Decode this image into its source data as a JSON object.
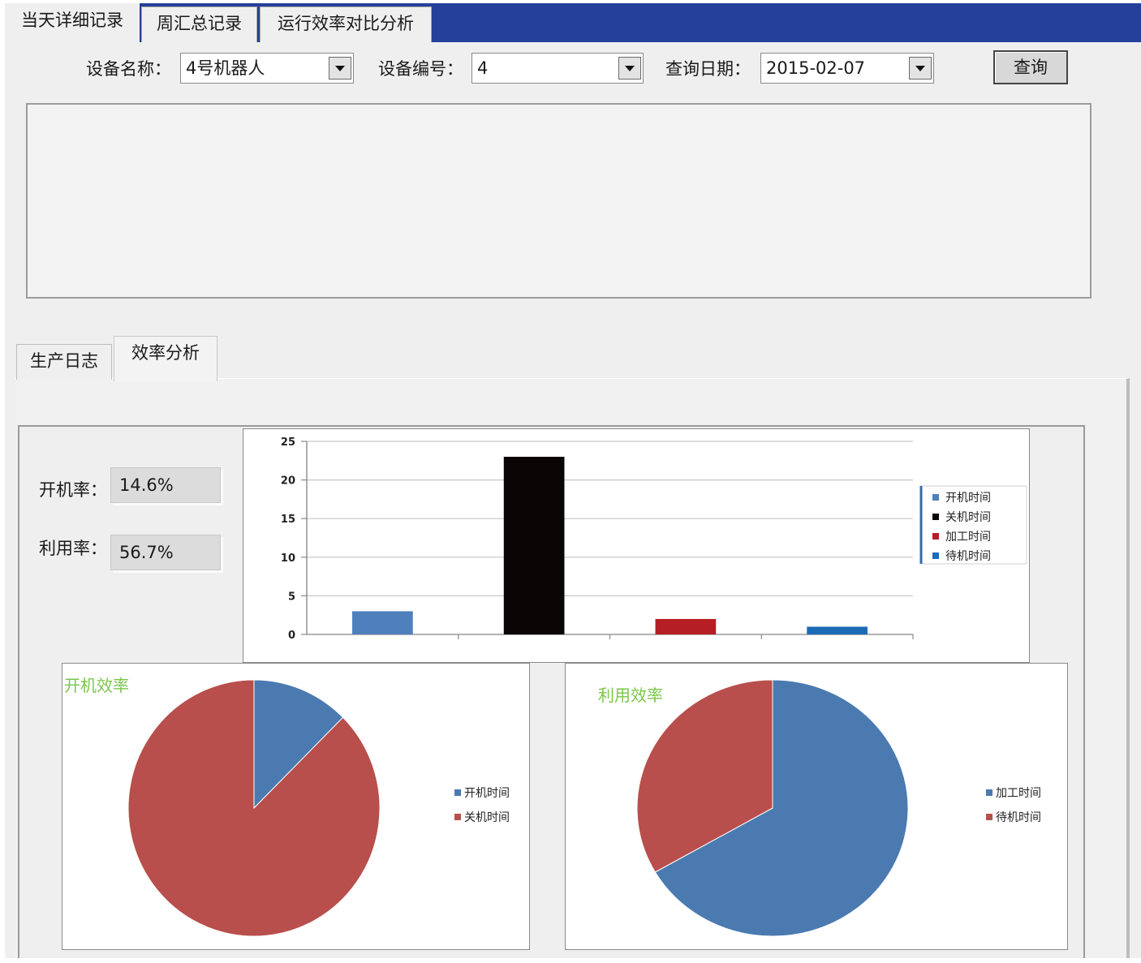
{
  "top_tabs": [
    {
      "label": "当天详细记录",
      "active": true
    },
    {
      "label": "周汇总记录",
      "active": false
    },
    {
      "label": "运行效率对比分析",
      "active": false
    }
  ],
  "query": {
    "device_name_label": "设备名称：",
    "device_name_value": "4号机器人",
    "device_id_label": "设备编号：",
    "device_id_value": "4",
    "date_label": "查询日期：",
    "date_value": "2015-02-07",
    "search_button": "查询"
  },
  "sub_tabs": [
    {
      "label": "生产日志",
      "active": false
    },
    {
      "label": "效率分析",
      "active": true
    }
  ],
  "rates": {
    "boot_label": "开机率：",
    "boot_value": "14.6%",
    "util_label": "利用率：",
    "util_value": "56.7%"
  },
  "colors": {
    "header_bar": "#25409a",
    "boot_time": "#4f7fbc",
    "off_time": "#0a0606",
    "process_time": "#b51e24",
    "standby_time": "#1c6bb6",
    "pie_blue": "#4a7ab0",
    "pie_red": "#b84f4c",
    "pie_title": "#7bc64a"
  },
  "chart_data": [
    {
      "type": "bar",
      "categories": [
        "开机时间",
        "关机时间",
        "加工时间",
        "待机时间"
      ],
      "values": [
        3,
        23,
        2,
        1
      ],
      "ylim": [
        0,
        25
      ],
      "yticks": [
        0,
        5,
        10,
        15,
        20,
        25
      ],
      "yticks_labels": [
        "0",
        "5",
        "10",
        "15",
        "20",
        "25"
      ],
      "grid": true,
      "legend": "right",
      "legend_entries": [
        "开机时间",
        "关机时间",
        "加工时间",
        "待机时间"
      ]
    },
    {
      "type": "pie",
      "title": "开机效率",
      "labels": [
        "开机时间",
        "关机时间"
      ],
      "values": [
        3,
        21
      ],
      "legend": "right"
    },
    {
      "type": "pie",
      "title": "利用效率",
      "labels": [
        "加工时间",
        "待机时间"
      ],
      "values": [
        2,
        1
      ],
      "legend": "right"
    }
  ]
}
